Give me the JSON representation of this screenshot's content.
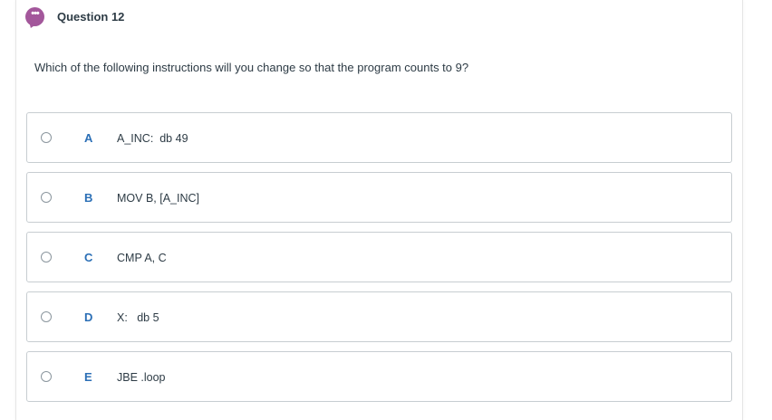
{
  "question": {
    "icon": "speech-bubble-dots-icon",
    "icon_glyph": "•••",
    "title": "Question 12",
    "text": "Which of the following instructions will you change so that the program counts to 9?"
  },
  "options": [
    {
      "letter": "A",
      "text": "A_INC:  db 49"
    },
    {
      "letter": "B",
      "text": "MOV B, [A_INC]"
    },
    {
      "letter": "C",
      "text": "CMP A, C"
    },
    {
      "letter": "D",
      "text": "X:   db 5"
    },
    {
      "letter": "E",
      "text": "JBE .loop"
    }
  ],
  "colors": {
    "accent_purple": "#a3579b",
    "letter_blue": "#2b6fb6",
    "border_gray": "#c7cdd1",
    "text_dark": "#2d3b45"
  }
}
